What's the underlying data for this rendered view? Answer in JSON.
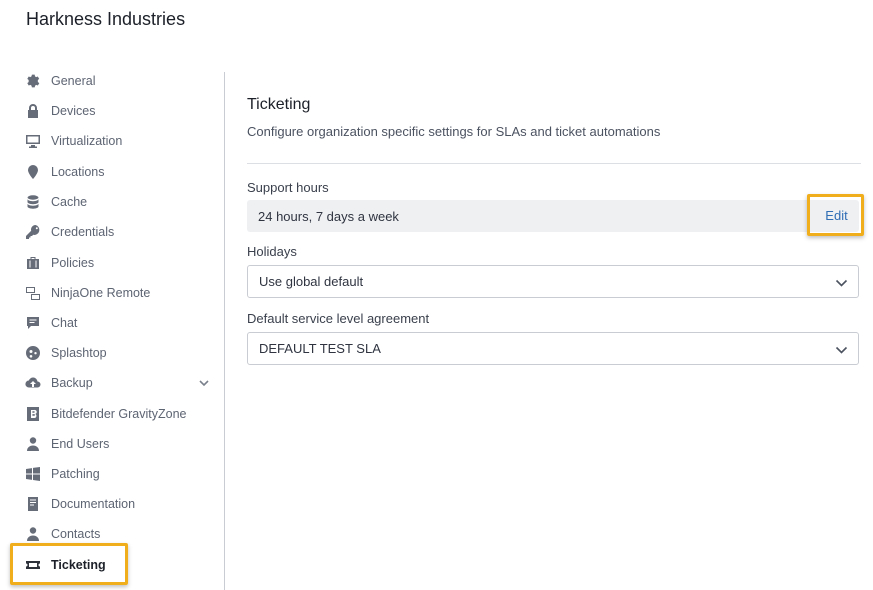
{
  "organization": {
    "name": "Harkness Industries"
  },
  "sidebar": {
    "items": [
      {
        "label": "General",
        "icon": "gear-icon"
      },
      {
        "label": "Devices",
        "icon": "lock-icon"
      },
      {
        "label": "Virtualization",
        "icon": "monitor-icon"
      },
      {
        "label": "Locations",
        "icon": "map-pin-icon"
      },
      {
        "label": "Cache",
        "icon": "database-icon"
      },
      {
        "label": "Credentials",
        "icon": "key-icon"
      },
      {
        "label": "Policies",
        "icon": "briefcase-icon"
      },
      {
        "label": "NinjaOne Remote",
        "icon": "remote-desktop-icon"
      },
      {
        "label": "Chat",
        "icon": "chat-icon"
      },
      {
        "label": "Splashtop",
        "icon": "splashtop-icon"
      },
      {
        "label": "Backup",
        "icon": "cloud-upload-icon",
        "expandable": true
      },
      {
        "label": "Bitdefender GravityZone",
        "icon": "bitdefender-icon"
      },
      {
        "label": "End Users",
        "icon": "user-icon"
      },
      {
        "label": "Patching",
        "icon": "windows-icon"
      },
      {
        "label": "Documentation",
        "icon": "book-icon"
      },
      {
        "label": "Contacts",
        "icon": "contact-icon"
      },
      {
        "label": "Ticketing",
        "icon": "ticket-icon",
        "active": true
      }
    ]
  },
  "ticketing": {
    "title": "Ticketing",
    "description": "Configure organization specific settings for SLAs and ticket automations",
    "support_hours": {
      "label": "Support hours",
      "value": "24 hours, 7 days a week",
      "edit_label": "Edit"
    },
    "holidays": {
      "label": "Holidays",
      "value": "Use global default"
    },
    "sla": {
      "label": "Default service level agreement",
      "value": "DEFAULT TEST SLA"
    }
  },
  "colors": {
    "highlight": "#f0ad1c",
    "link": "#2f6db5",
    "active_text": "#1c2028",
    "inactive_text": "#5d6472"
  }
}
